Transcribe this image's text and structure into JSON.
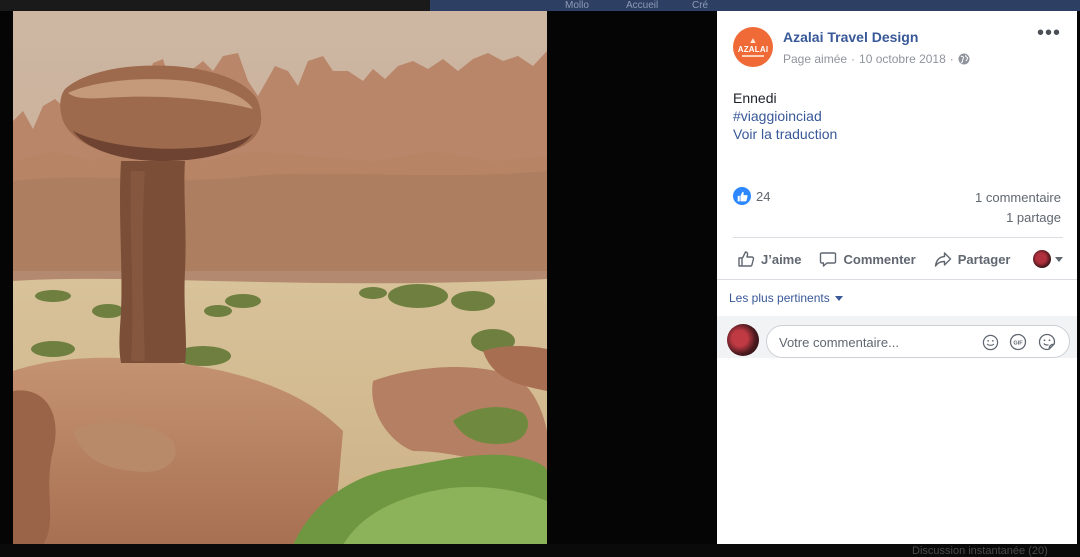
{
  "background": {
    "top_fragments": [
      "Mollo",
      "Accueil",
      "Cré"
    ],
    "bottom_fragments": [
      "Discussion instantanée (20)"
    ]
  },
  "photo": {
    "alt": "Ennedi"
  },
  "post": {
    "page_name": "Azalai Travel Design",
    "avatar_text": "AZALAI",
    "page_liked": "Page aimée",
    "separator": "·",
    "date": "10 octobre 2018",
    "more_label": "•••",
    "text_line": "Ennedi",
    "hashtag": "#viaggioinciad",
    "translate_link": "Voir la traduction",
    "like_count": "24",
    "comments_count": "1 commentaire",
    "shares_count": "1 partage",
    "actions": {
      "like": "J’aime",
      "comment": "Commenter",
      "share": "Partager"
    },
    "sort_label": "Les plus pertinents",
    "comment_placeholder": "Votre commentaire..."
  },
  "colors": {
    "link": "#385898",
    "avatar": "#ef6a36",
    "like_badge": "#2d88ff"
  }
}
